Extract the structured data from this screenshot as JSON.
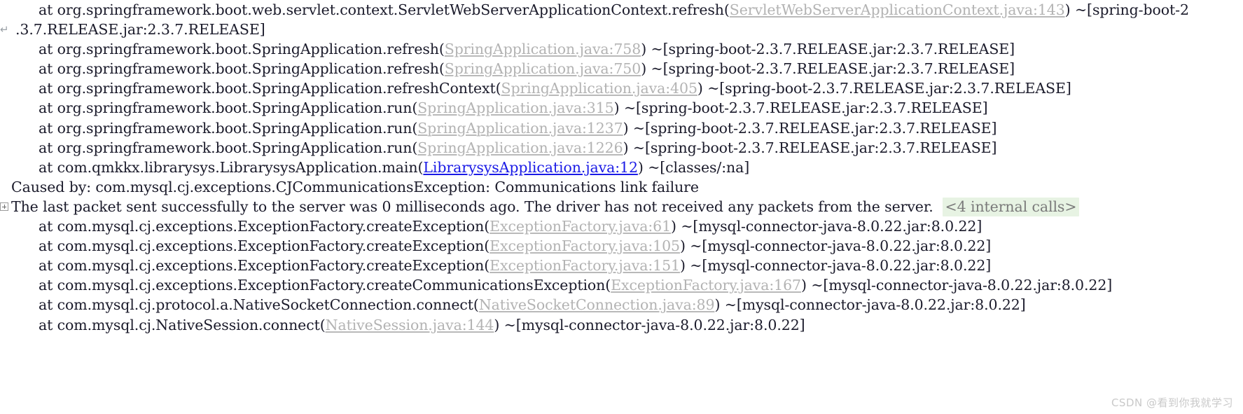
{
  "console": {
    "app": "stack-trace-console",
    "colors": {
      "background": "#ffffff",
      "text": "#1b1b2b",
      "library_link": "#b3b3b3",
      "user_link": "#1a1ae6",
      "fold_badge_bg": "#e7f3e3",
      "fold_badge_text": "#7a7a7a",
      "watermark": "#c9c9c9"
    },
    "lines": [
      {
        "id": "line-1",
        "kind": "at",
        "prefix": "at org.springframework.boot.web.servlet.context.ServletWebServerApplicationContext.refresh(",
        "link": "ServletWebServerApplicationContext.java:143",
        "link_type": "library",
        "suffix": ") ~[spring-boot-2",
        "wrapped": true,
        "wrap_text": ".3.7.RELEASE.jar:2.3.7.RELEASE]"
      },
      {
        "id": "line-2",
        "kind": "at",
        "prefix": "at org.springframework.boot.SpringApplication.refresh(",
        "link": "SpringApplication.java:758",
        "link_type": "library",
        "suffix": ") ~[spring-boot-2.3.7.RELEASE.jar:2.3.7.RELEASE]"
      },
      {
        "id": "line-3",
        "kind": "at",
        "prefix": "at org.springframework.boot.SpringApplication.refresh(",
        "link": "SpringApplication.java:750",
        "link_type": "library",
        "suffix": ") ~[spring-boot-2.3.7.RELEASE.jar:2.3.7.RELEASE]"
      },
      {
        "id": "line-4",
        "kind": "at",
        "prefix": "at org.springframework.boot.SpringApplication.refreshContext(",
        "link": "SpringApplication.java:405",
        "link_type": "library",
        "suffix": ") ~[spring-boot-2.3.7.RELEASE.jar:2.3.7.RELEASE]"
      },
      {
        "id": "line-5",
        "kind": "at",
        "prefix": "at org.springframework.boot.SpringApplication.run(",
        "link": "SpringApplication.java:315",
        "link_type": "library",
        "suffix": ") ~[spring-boot-2.3.7.RELEASE.jar:2.3.7.RELEASE]"
      },
      {
        "id": "line-6",
        "kind": "at",
        "prefix": "at org.springframework.boot.SpringApplication.run(",
        "link": "SpringApplication.java:1237",
        "link_type": "library",
        "suffix": ") ~[spring-boot-2.3.7.RELEASE.jar:2.3.7.RELEASE]"
      },
      {
        "id": "line-7",
        "kind": "at",
        "prefix": "at org.springframework.boot.SpringApplication.run(",
        "link": "SpringApplication.java:1226",
        "link_type": "library",
        "suffix": ") ~[spring-boot-2.3.7.RELEASE.jar:2.3.7.RELEASE]"
      },
      {
        "id": "line-8",
        "kind": "at",
        "prefix": "at com.qmkkx.librarysys.LibrarysysApplication.main(",
        "link": "LibrarysysApplication.java:12",
        "link_type": "user",
        "suffix": ") ~[classes/:na]"
      },
      {
        "id": "line-9",
        "kind": "caused",
        "text": "Caused by: com.mysql.cj.exceptions.CJCommunicationsException: Communications link failure"
      },
      {
        "id": "line-10",
        "kind": "message",
        "fold_marker": "expand-fold-box",
        "text": "The last packet sent successfully to the server was 0 milliseconds ago. The driver has not received any packets from the server.",
        "badge": "<4 internal calls>"
      },
      {
        "id": "line-11",
        "kind": "at",
        "prefix": "at com.mysql.cj.exceptions.ExceptionFactory.createException(",
        "link": "ExceptionFactory.java:61",
        "link_type": "library",
        "suffix": ") ~[mysql-connector-java-8.0.22.jar:8.0.22]"
      },
      {
        "id": "line-12",
        "kind": "at",
        "prefix": "at com.mysql.cj.exceptions.ExceptionFactory.createException(",
        "link": "ExceptionFactory.java:105",
        "link_type": "library",
        "suffix": ") ~[mysql-connector-java-8.0.22.jar:8.0.22]"
      },
      {
        "id": "line-13",
        "kind": "at",
        "prefix": "at com.mysql.cj.exceptions.ExceptionFactory.createException(",
        "link": "ExceptionFactory.java:151",
        "link_type": "library",
        "suffix": ") ~[mysql-connector-java-8.0.22.jar:8.0.22]"
      },
      {
        "id": "line-14",
        "kind": "at",
        "prefix": "at com.mysql.cj.exceptions.ExceptionFactory.createCommunicationsException(",
        "link": "ExceptionFactory.java:167",
        "link_type": "library",
        "suffix": ") ~[mysql-connector-java-8.0.22.jar:8.0.22]"
      },
      {
        "id": "line-15",
        "kind": "at",
        "prefix": "at com.mysql.cj.protocol.a.NativeSocketConnection.connect(",
        "link": "NativeSocketConnection.java:89",
        "link_type": "library",
        "suffix": ") ~[mysql-connector-java-8.0.22.jar:8.0.22]"
      },
      {
        "id": "line-16",
        "kind": "at",
        "prefix": "at com.mysql.cj.NativeSession.connect(",
        "link": "NativeSession.java:144",
        "link_type": "library",
        "suffix": ") ~[mysql-connector-java-8.0.22.jar:8.0.22]"
      }
    ]
  },
  "watermark": {
    "text": "CSDN @看到你我就学习"
  }
}
